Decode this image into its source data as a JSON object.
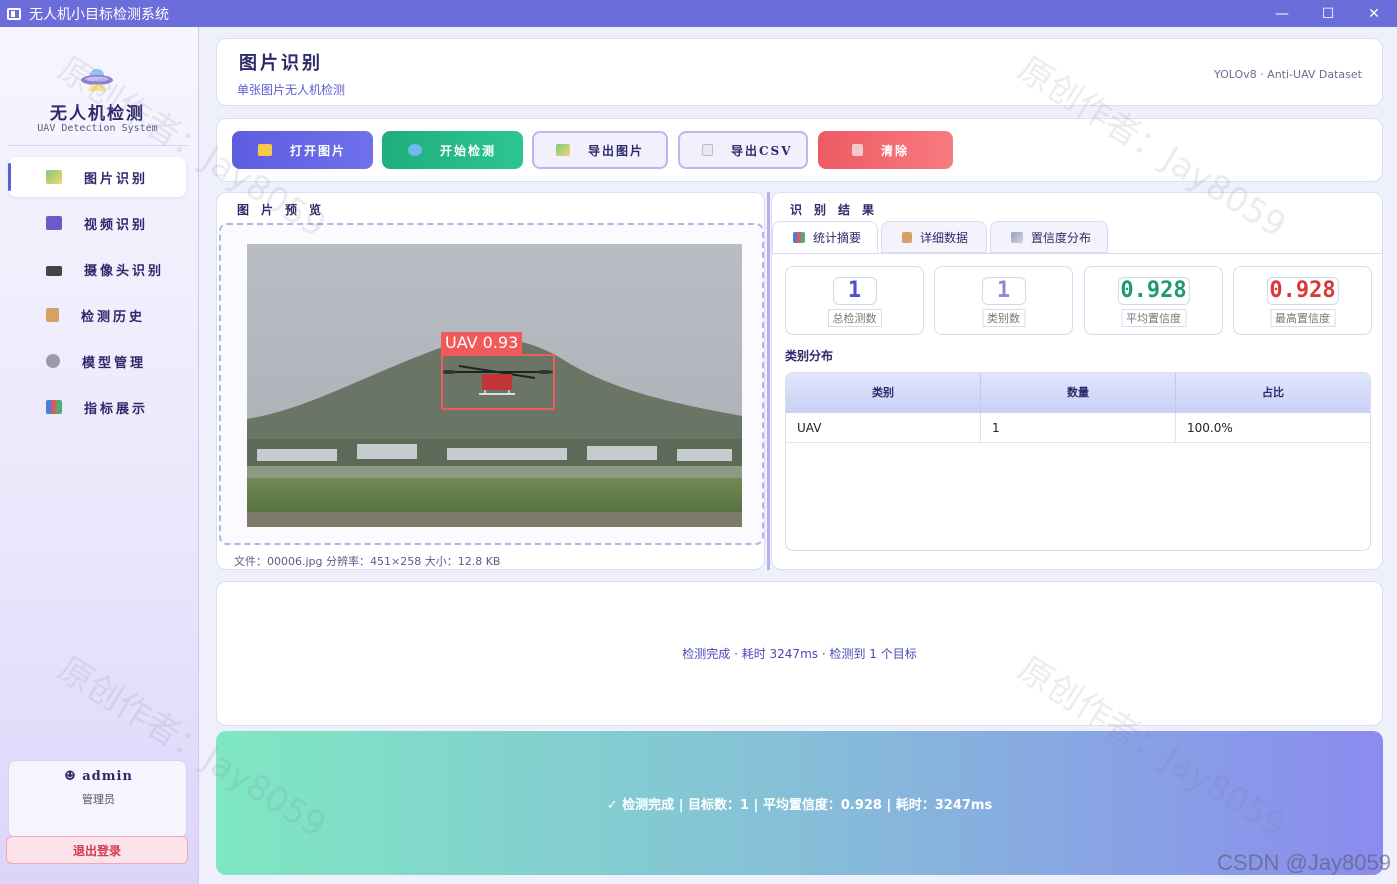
{
  "window": {
    "title": "无人机小目标检测系统",
    "controls": {
      "minimize": "—",
      "maximize": "☐",
      "close": "✕"
    }
  },
  "sidebar": {
    "logo_title": "无人机检测",
    "logo_subtitle": "UAV Detection System",
    "items": [
      {
        "label": "图片识别",
        "icon": "image-icon",
        "active": true
      },
      {
        "label": "视频识别",
        "icon": "video-icon",
        "active": false
      },
      {
        "label": "摄像头识别",
        "icon": "camera-icon",
        "active": false
      },
      {
        "label": "检测历史",
        "icon": "clipboard-icon",
        "active": false
      },
      {
        "label": "模型管理",
        "icon": "gear-icon",
        "active": false
      },
      {
        "label": "指标展示",
        "icon": "bar-chart-icon",
        "active": false
      }
    ],
    "user": {
      "name": "admin",
      "role": "管理员",
      "logout_label": "退出登录"
    }
  },
  "header": {
    "title": "图片识别",
    "subtitle": "单张图片无人机检测",
    "right_text": "YOLOv8 · Anti-UAV Dataset"
  },
  "toolbar": {
    "open_label": "打开图片",
    "detect_label": "开始检测",
    "export_image_label": "导出图片",
    "export_csv_label": "导出CSV",
    "clear_label": "清除"
  },
  "preview": {
    "title": "图片预览",
    "detection_label": "UAV 0.93",
    "file_info": "文件：00006.jpg    分辨率：451×258    大小：12.8 KB"
  },
  "results": {
    "title": "识别结果",
    "tabs": [
      "统计摘要",
      "详细数据",
      "置信度分布"
    ],
    "stats": [
      {
        "value": "1",
        "label": "总检测数",
        "color": "#4f4fd0"
      },
      {
        "value": "1",
        "label": "类别数",
        "color": "#9b82e0"
      },
      {
        "value": "0.928",
        "label": "平均置信度",
        "color": "#1f9a6e"
      },
      {
        "value": "0.928",
        "label": "最高置信度",
        "color": "#d83a3a"
      }
    ],
    "distribution_title": "类别分布",
    "table": {
      "headers": [
        "类别",
        "数量",
        "占比"
      ],
      "rows": [
        [
          "UAV",
          "1",
          "100.0%"
        ]
      ]
    }
  },
  "log": {
    "message": "检测完成 · 耗时 3247ms · 检测到 1 个目标"
  },
  "status": {
    "message": "✓  检测完成  |  目标数：1  |  平均置信度：0.928  |  耗时：3247ms"
  },
  "watermarks": {
    "author": "原创作者：Jay8059",
    "csdn": "CSDN @Jay8059"
  },
  "colors": {
    "accent": "#6b6ddb",
    "success": "#1fae7c",
    "danger": "#ee5a63"
  }
}
